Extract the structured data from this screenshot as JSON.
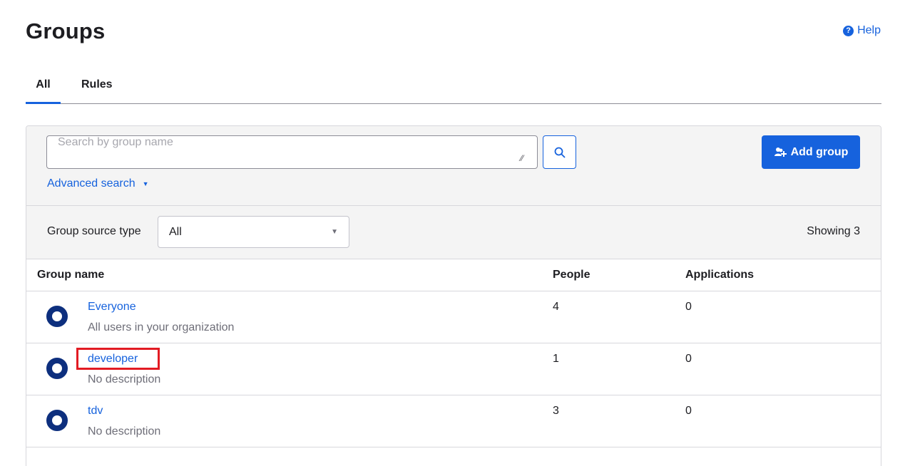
{
  "header": {
    "title": "Groups",
    "help_label": "Help",
    "help_icon": "question-circle-icon"
  },
  "tabs": [
    {
      "label": "All",
      "active": true
    },
    {
      "label": "Rules",
      "active": false
    }
  ],
  "search": {
    "placeholder": "Search by group name",
    "value": "",
    "button_icon": "search-icon",
    "advanced_label": "Advanced search"
  },
  "add_group": {
    "label": "Add group",
    "icon": "add-group-icon"
  },
  "filter": {
    "label": "Group source type",
    "selected": "All",
    "showing_text": "Showing 3"
  },
  "table": {
    "columns": [
      "Group name",
      "People",
      "Applications"
    ],
    "rows": [
      {
        "name": "Everyone",
        "description": "All users in your organization",
        "people": "4",
        "applications": "0"
      },
      {
        "name": "developer",
        "description": "No description",
        "people": "1",
        "applications": "0"
      },
      {
        "name": "tdv",
        "description": "No description",
        "people": "3",
        "applications": "0"
      }
    ]
  },
  "colors": {
    "accent": "#1662dd",
    "icon_dark": "#0d2f7e",
    "highlight": "#e21b23",
    "panel_bg": "#f4f4f4"
  }
}
